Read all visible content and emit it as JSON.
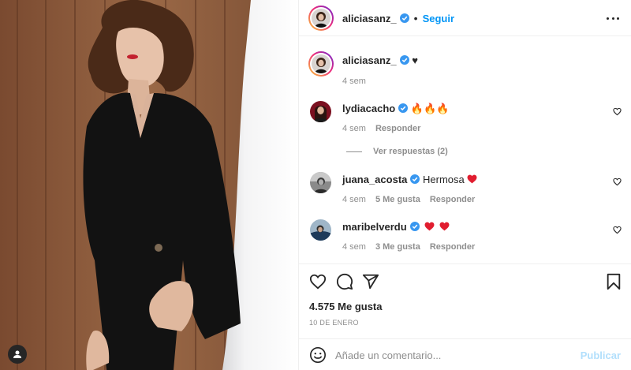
{
  "header": {
    "username": "aliciasanz_",
    "separator": "•",
    "follow_label": "Seguir"
  },
  "caption": {
    "username": "aliciasanz_",
    "text": "♥",
    "time": "4 sem"
  },
  "comments": [
    {
      "username": "lydiacacho",
      "text": "🔥🔥🔥",
      "time": "4 sem",
      "likes": "",
      "reply_label": "Responder"
    },
    {
      "username": "juana_acosta",
      "text": "Hermosa",
      "time": "4 sem",
      "likes": "5 Me gusta",
      "reply_label": "Responder"
    },
    {
      "username": "maribelverdu",
      "text": "",
      "time": "4 sem",
      "likes": "3 Me gusta",
      "reply_label": "Responder"
    }
  ],
  "view_replies": "Ver respuestas (2)",
  "likes_count": "4.575 Me gusta",
  "post_date": "10 DE ENERO",
  "composer": {
    "placeholder": "Añade un comentario...",
    "publish_label": "Publicar"
  },
  "colors": {
    "accent": "#0095f6",
    "publish_disabled": "#b2dffc",
    "verified": "#3897f0",
    "heart_red": "#ed4956",
    "secondary_text": "#8e8e8e"
  },
  "icons": [
    "more-options-icon",
    "verified-badge-icon",
    "heart-icon",
    "comment-icon",
    "share-icon",
    "bookmark-icon",
    "emoji-icon",
    "user-tag-icon",
    "fire-emoji",
    "red-heart-emoji"
  ]
}
